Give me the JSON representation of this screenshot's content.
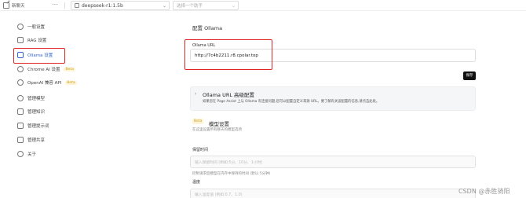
{
  "topbar": {
    "new_chat_label": "新聊天",
    "more_label": "···",
    "model_value": "deepseek-r1:1.5b",
    "knowledge_placeholder": "选择一个助手"
  },
  "sidebar": {
    "items": [
      {
        "label": "一般设置",
        "icon": "gear-icon"
      },
      {
        "label": "RAG 设置",
        "icon": "database-icon"
      },
      {
        "label": "Ollama 设置",
        "icon": "llama-icon"
      },
      {
        "label": "Chrome AI 设置",
        "icon": "chrome-icon",
        "badge": "Beta"
      },
      {
        "label": "OpenAI 兼容 API",
        "icon": "openai-icon",
        "badge": "Beta"
      },
      {
        "label": "管理模型",
        "icon": "brain-icon"
      },
      {
        "label": "管理知识",
        "icon": "book-icon"
      },
      {
        "label": "管理提示词",
        "icon": "prompt-icon"
      },
      {
        "label": "管理共享",
        "icon": "share-icon"
      },
      {
        "label": "关于",
        "icon": "info-icon"
      }
    ]
  },
  "main": {
    "section_title": "配置 Ollama",
    "url_label": "Ollama URL",
    "url_value": "http://7c4b2211.r8.cpolar.top",
    "save_label": "保存",
    "advanced": {
      "title": "Ollama URL 高级配置",
      "description": "如果您在 Page Assist 上与 Ollama 有连接问题,您可以配置自定义来源 URL。要了解有关该配置的信息,请点击此处。"
    },
    "model_settings": {
      "badge": "Beta",
      "title": "模型设置",
      "description": "在这里设置所有聊天的模型选项"
    },
    "keep_alive": {
      "label": "保留时间",
      "placeholder": "输入保留时间 (例如:5分、10分、1小时)",
      "help": "控制请求后模型在内存中保持的时间 (默认:5分钟)"
    },
    "temperature": {
      "label": "温度",
      "placeholder": "输入温度值 (例如:0.7、1.0)"
    }
  },
  "watermark": "CSDN @赤胜骑阳",
  "colors": {
    "highlight_box": "#e02424",
    "save_button": "#111111",
    "active_item": "#3366cc",
    "beta_badge": "#c9a227"
  }
}
